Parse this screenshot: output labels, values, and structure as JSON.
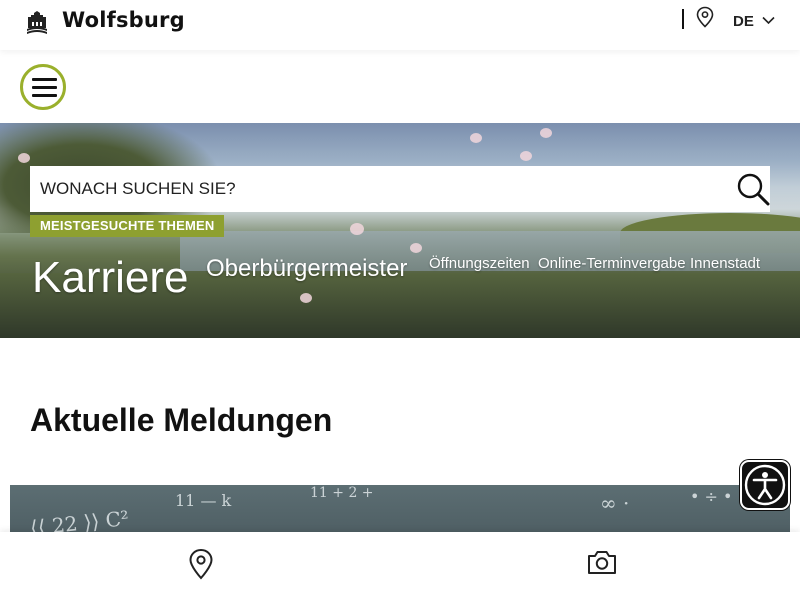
{
  "header": {
    "brand": "Wolfsburg",
    "language": "DE",
    "icons": {
      "logo": "city-crest-icon",
      "location": "map-pin-icon",
      "language_toggle": "chevron-down-icon"
    }
  },
  "menu": {
    "icon": "hamburger-menu-icon",
    "accent_color": "#9ab02c"
  },
  "hero": {
    "search": {
      "placeholder": "WONACH SUCHEN SIE?",
      "icon": "search-icon"
    },
    "popular_label": "MEISTGESUCHTE THEMEN",
    "popular_label_color": "#8ea030",
    "topics": [
      "Karriere",
      "Oberbürgermeister",
      "Öffnungszeiten",
      "Online-Terminvergabe",
      "Innenstadt"
    ]
  },
  "news": {
    "title": "Aktuelle Meldungen"
  },
  "accessibility": {
    "icon": "accessibility-person-icon"
  },
  "bottom_bar": {
    "icons": [
      "map-pin-icon",
      "camera-icon"
    ]
  }
}
